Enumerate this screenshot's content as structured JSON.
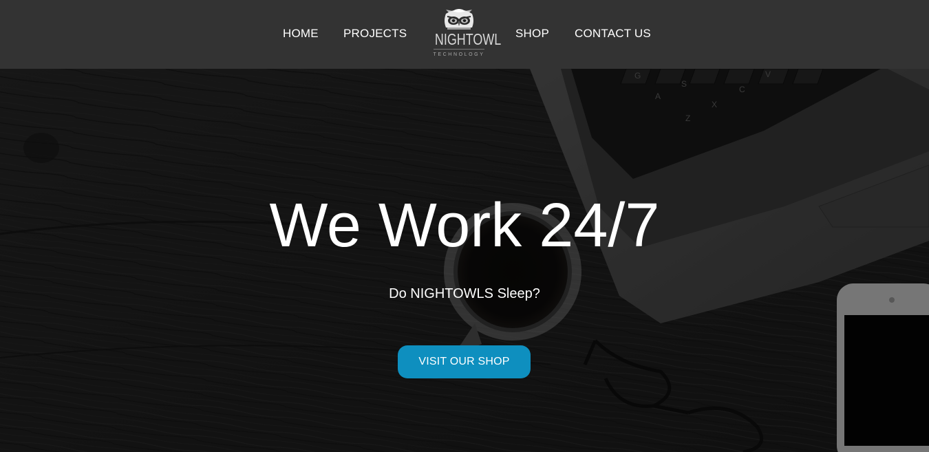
{
  "nav": {
    "links": [
      "HOME",
      "PROJECTS",
      "SHOP",
      "CONTACT US"
    ],
    "logo": {
      "wordmark": "NIGHTOWL",
      "tagline": "TECHNOLOGY",
      "icon": "owl-icon"
    }
  },
  "hero": {
    "title": "We Work 24/7",
    "subtitle": "Do NIGHTOWLS Sleep?",
    "cta_label": "VISIT OUR SHOP",
    "background": "dark-wood-desk-with-laptop-coffee-phone-glasses",
    "keyboard_keys": [
      "G",
      "S",
      "A",
      "Z",
      "X",
      "C",
      "V"
    ]
  },
  "colors": {
    "navbar_bg": "#333333",
    "accent": "#0e8fbf",
    "text": "#ffffff"
  }
}
